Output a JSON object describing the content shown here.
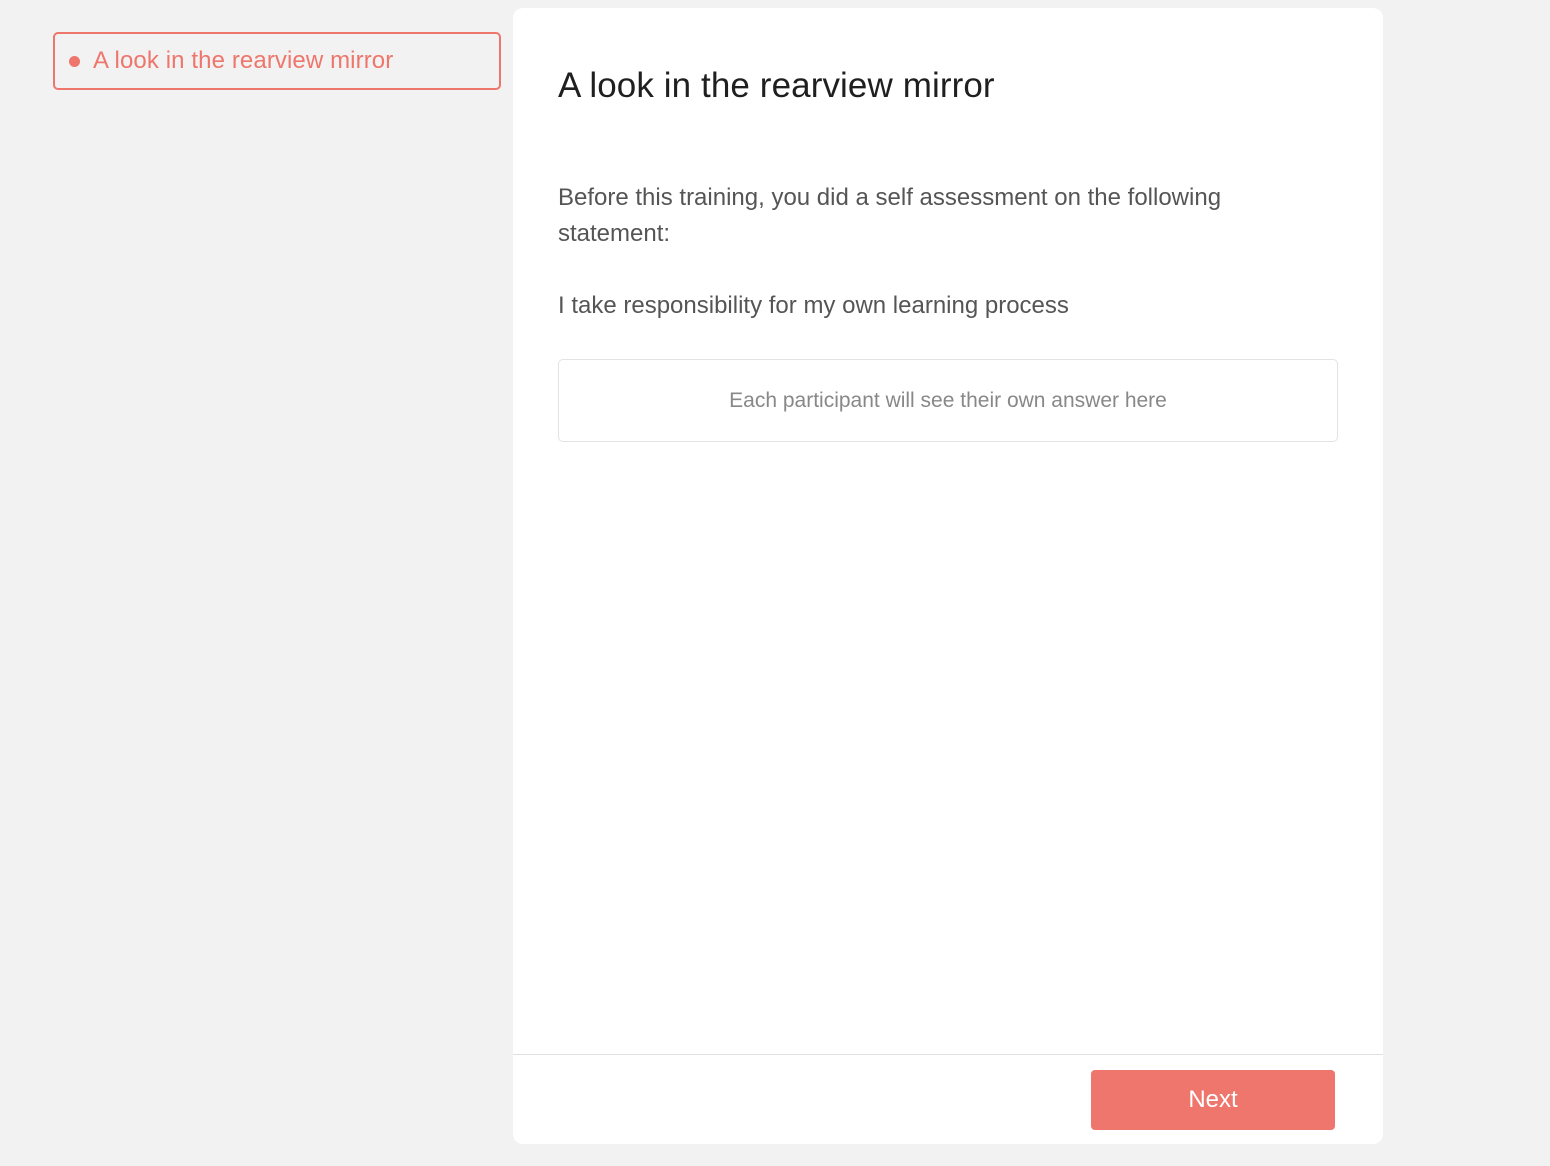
{
  "sidebar": {
    "items": [
      {
        "label": "A look in the rearview mirror",
        "active": true
      }
    ]
  },
  "main": {
    "title": "A look in the rearview mirror",
    "intro": "Before this training, you did a self assessment on the following statement:",
    "statement": "I take responsibility for my own learning process",
    "answer_placeholder": "Each participant will see their own answer here"
  },
  "footer": {
    "next_label": "Next"
  },
  "colors": {
    "accent": "#ee766c",
    "background": "#f2f2f2",
    "card": "#ffffff",
    "title_text": "#1f1f1f",
    "body_text": "#555555",
    "placeholder_text": "#888888"
  }
}
